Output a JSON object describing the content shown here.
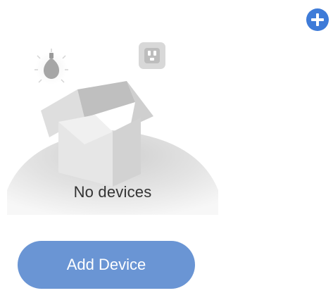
{
  "header": {
    "add_icon": "plus-circle-icon"
  },
  "empty_state": {
    "message": "No devices",
    "illustration_icons": [
      "lightbulb-icon",
      "smart-plug-icon",
      "open-box-icon"
    ]
  },
  "actions": {
    "add_device_label": "Add Device"
  },
  "colors": {
    "accent": "#3e7bd8",
    "button": "#6a95d4",
    "text": "#333333",
    "illustration_gray": "#d9d9d9"
  }
}
